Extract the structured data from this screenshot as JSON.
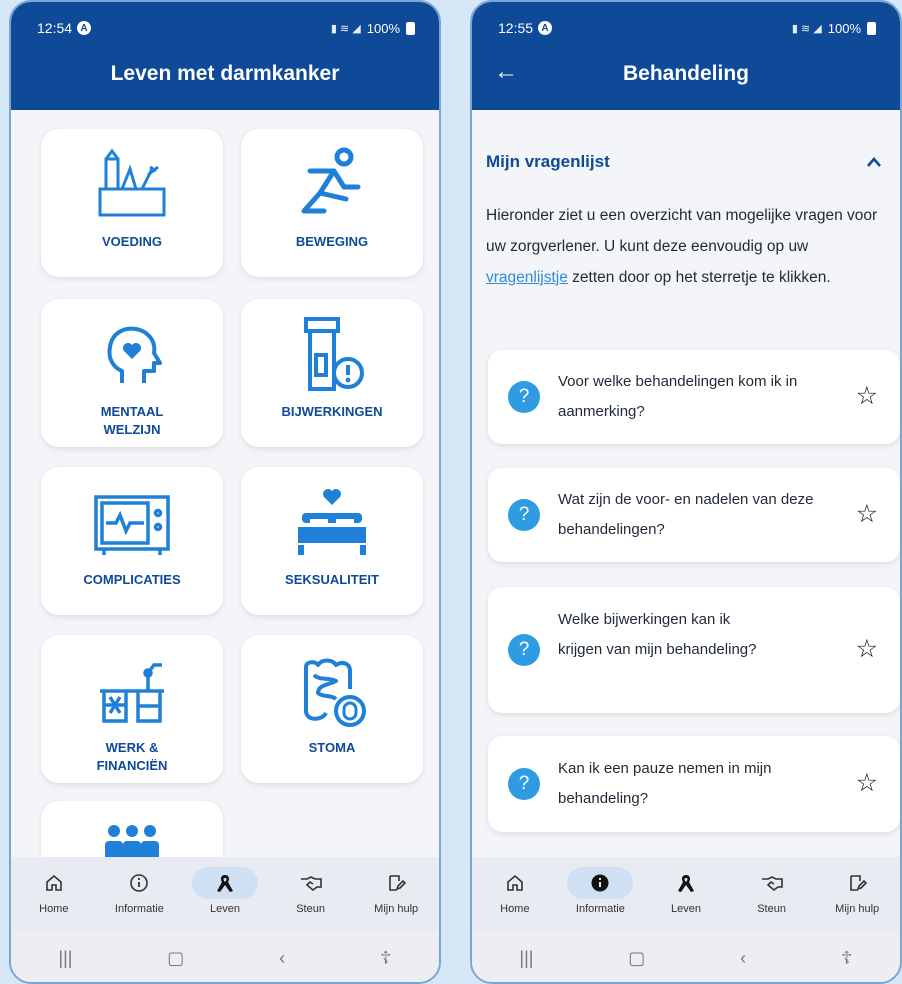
{
  "left": {
    "status": {
      "time": "12:54",
      "battery": "100%"
    },
    "title": "Leven met darmkanker",
    "tiles": [
      {
        "label": "VOEDING",
        "icon": "groceries-icon"
      },
      {
        "label": "BEWEGING",
        "icon": "running-person-icon"
      },
      {
        "label": "MENTAAL\nWELZIJN",
        "icon": "head-heart-icon"
      },
      {
        "label": "BIJWERKINGEN",
        "icon": "pill-bottle-alert-icon"
      },
      {
        "label": "COMPLICATIES",
        "icon": "heart-monitor-icon"
      },
      {
        "label": "SEKSUALITEIT",
        "icon": "bed-heart-icon"
      },
      {
        "label": "WERK &\nFINANCIËN",
        "icon": "desk-lamp-icon"
      },
      {
        "label": "STOMA",
        "icon": "intestine-icon"
      },
      {
        "label": "",
        "icon": "people-group-icon"
      }
    ]
  },
  "right": {
    "status": {
      "time": "12:55",
      "battery": "100%"
    },
    "title": "Behandeling",
    "section_title": "Mijn vragenlijst",
    "intro_before": "Hieronder ziet u een overzicht van mogelijke vragen voor uw zorgverlener. U kunt deze eenvoudig op uw ",
    "intro_link": "vragenlijstje",
    "intro_after": " zetten door op het sterretje te klikken.",
    "questions": [
      "Voor welke behandelingen kom ik in aanmerking?",
      "Wat zijn de voor- en nadelen van deze behandelingen?",
      "Welke bijwerkingen kan ik krijgen van mijn behandeling?",
      "Kan ik een pauze nemen in mijn behandeling?"
    ]
  },
  "nav": [
    "Home",
    "Informatie",
    "Leven",
    "Steun",
    "Mijn hulp"
  ],
  "colors": {
    "primary": "#0e4a97",
    "accent": "#2f9be3",
    "link": "#2f8bd8"
  }
}
